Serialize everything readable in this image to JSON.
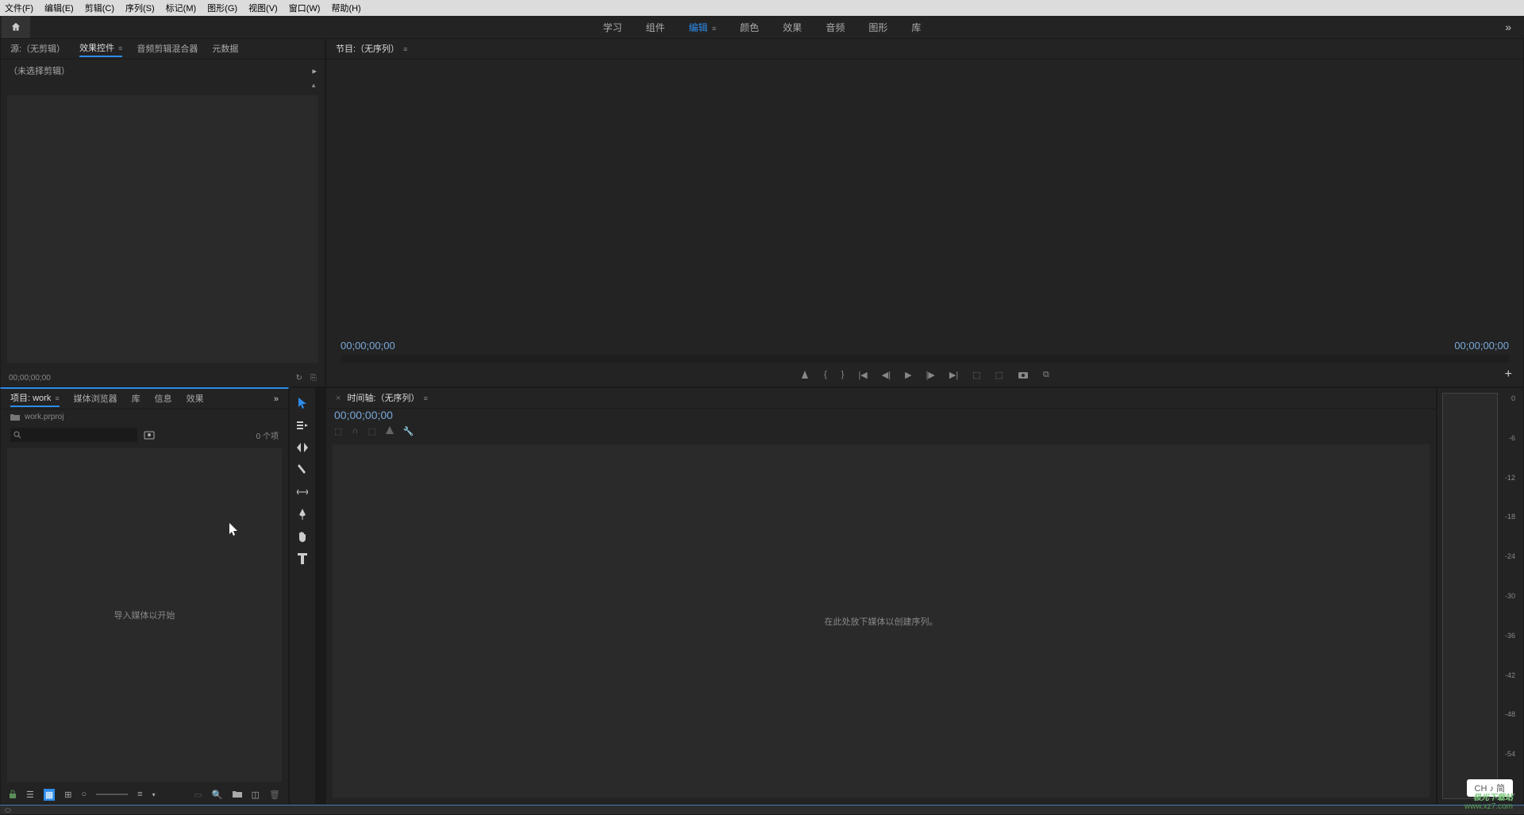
{
  "menubar": {
    "items": [
      "文件(F)",
      "编辑(E)",
      "剪辑(C)",
      "序列(S)",
      "标记(M)",
      "图形(G)",
      "视图(V)",
      "窗口(W)",
      "帮助(H)"
    ]
  },
  "workspace": {
    "tabs": [
      "学习",
      "组件",
      "编辑",
      "颜色",
      "效果",
      "音频",
      "图形",
      "库"
    ],
    "active": "编辑"
  },
  "source_panel": {
    "tabs": [
      "源:（无剪辑）",
      "效果控件",
      "音频剪辑混合器",
      "元数据"
    ],
    "active": "效果控件",
    "no_selection": "（未选择剪辑）",
    "timecode": "00;00;00;00"
  },
  "program_panel": {
    "title": "节目:（无序列）",
    "timecode_left": "00;00;00;00",
    "timecode_right": "00;00;00;00"
  },
  "project_panel": {
    "tabs": [
      "项目: work",
      "媒体浏览器",
      "库",
      "信息",
      "效果"
    ],
    "active": "项目: work",
    "filename": "work.prproj",
    "item_count": "0 个项",
    "import_hint": "导入媒体以开始"
  },
  "timeline_panel": {
    "title": "时间轴:（无序列）",
    "timecode": "00;00;00;00",
    "drop_hint": "在此处放下媒体以创建序列。"
  },
  "audio_meter": {
    "scale": [
      "0",
      "-6",
      "-12",
      "-18",
      "-24",
      "-30",
      "-36",
      "-42",
      "-48",
      "-54",
      "--"
    ]
  },
  "ime": {
    "label": "CH ♪ 简"
  },
  "watermark": {
    "line1": "极光下载站",
    "line2": "www.xz7.com"
  }
}
